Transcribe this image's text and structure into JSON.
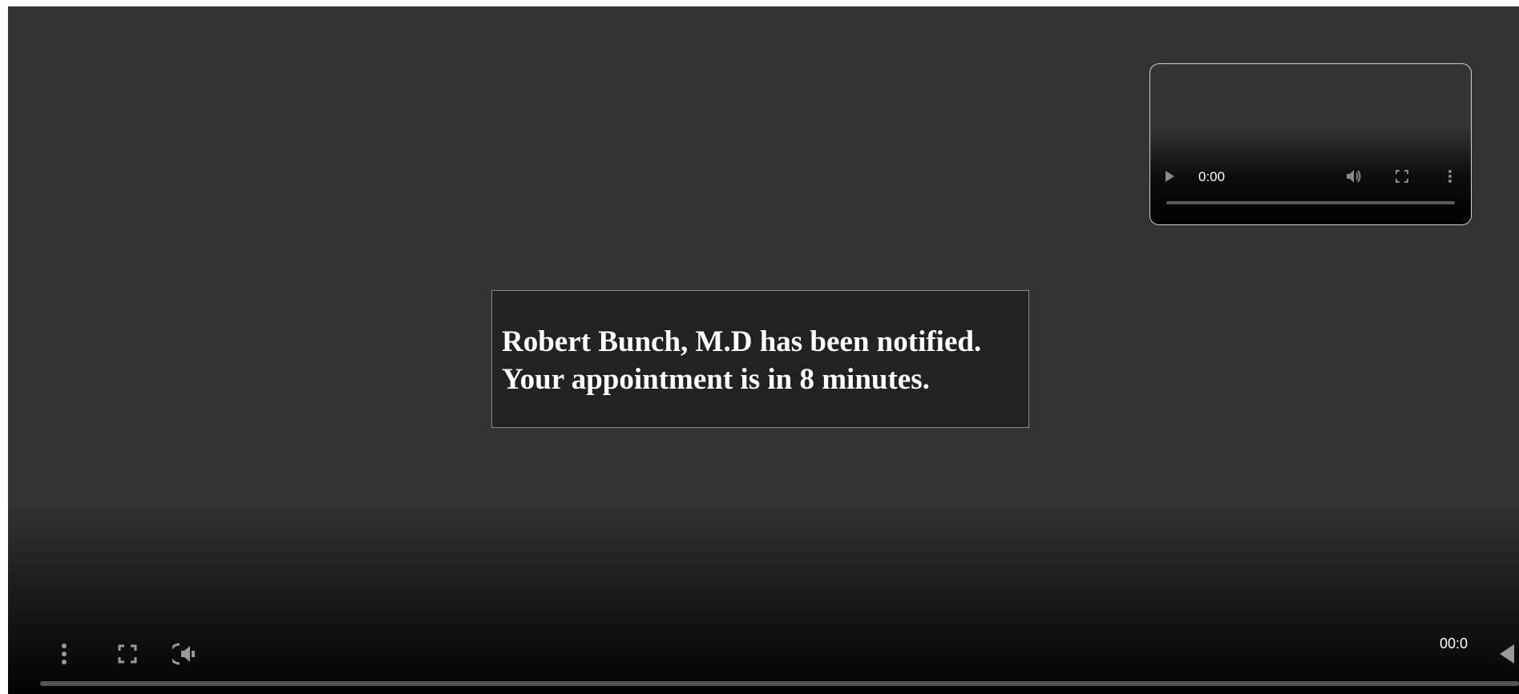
{
  "main_video": {
    "message_line1": "Robert Bunch, M.D has been notified.",
    "message_line2": "Your appointment is in 8 minutes.",
    "time": "00:0",
    "progress": 0,
    "controls": {
      "menu_icon": "more-vertical-icon",
      "fullscreen_icon": "fullscreen-icon",
      "audio_icon": "speaker-icon",
      "collapse_icon": "triangle-left-icon"
    }
  },
  "pip_video": {
    "time": "0:00",
    "progress": 0,
    "controls": {
      "play_icon": "play-icon",
      "volume_icon": "volume-icon",
      "fullscreen_icon": "fullscreen-icon",
      "menu_icon": "more-vertical-icon"
    }
  },
  "colors": {
    "background": "#333333",
    "notice_background": "#222222",
    "text": "#ffffff",
    "icon": "#9a9a9a"
  }
}
